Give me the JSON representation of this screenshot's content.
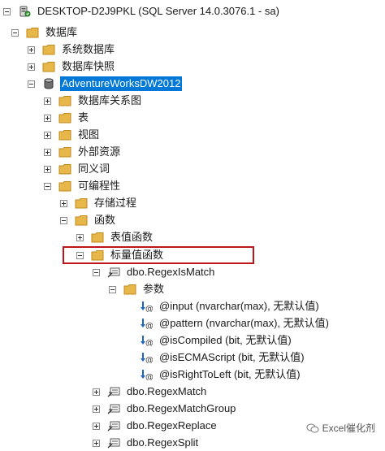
{
  "tree": {
    "server": "DESKTOP-D2J9PKL (SQL Server 14.0.3076.1 - sa)",
    "databases": "数据库",
    "system_databases": "系统数据库",
    "db_snapshots": "数据库快照",
    "adventureworks": "AdventureWorksDW2012",
    "db_diagrams": "数据库关系图",
    "tables": "表",
    "views": "视图",
    "external_resources": "外部资源",
    "synonyms": "同义词",
    "programmability": "可编程性",
    "stored_procedures": "存储过程",
    "functions": "函数",
    "table_valued_functions": "表值函数",
    "scalar_valued_functions": "标量值函数",
    "regex_ismatch": "dbo.RegexIsMatch",
    "parameters": "参数",
    "params": [
      "@input (nvarchar(max), 无默认值)",
      "@pattern (nvarchar(max), 无默认值)",
      "@isCompiled (bit, 无默认值)",
      "@isECMAScript (bit, 无默认值)",
      "@isRightToLeft (bit, 无默认值)"
    ],
    "regex_match": "dbo.RegexMatch",
    "regex_match_group": "dbo.RegexMatchGroup",
    "regex_replace": "dbo.RegexReplace",
    "regex_split": "dbo.RegexSplit"
  },
  "watermark": "Excel催化剂",
  "colors": {
    "selection": "#0078d7",
    "folder": "#e8b74a",
    "highlight_border": "#c0141c",
    "param_arrow": "#1e64c8"
  },
  "icons": {
    "server": "server-icon",
    "folder": "folder-icon",
    "database": "database-icon",
    "function": "function-icon",
    "parameter": "parameter-icon"
  }
}
